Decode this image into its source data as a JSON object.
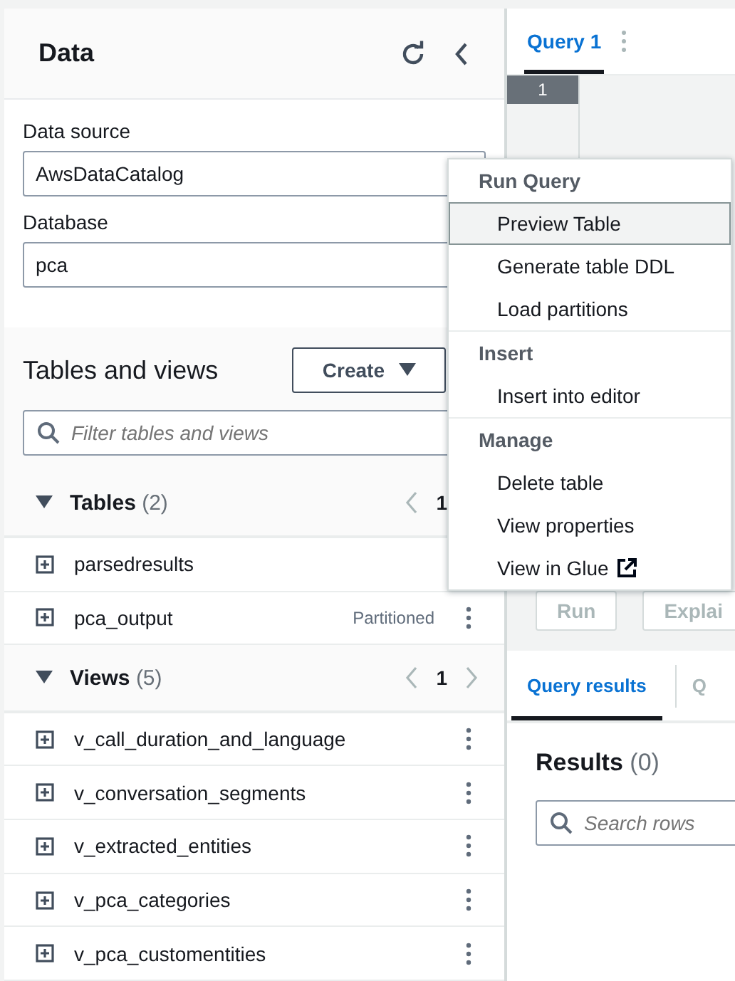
{
  "data_panel": {
    "title": "Data",
    "data_source": {
      "label": "Data source",
      "value": "AwsDataCatalog"
    },
    "database": {
      "label": "Database",
      "value": "pca"
    },
    "tables_and_views": {
      "title": "Tables and views",
      "create_button": "Create",
      "filter": {
        "placeholder": "Filter tables and views"
      },
      "sections": [
        {
          "title": "Tables",
          "count": "(2)",
          "expanded": true,
          "page": "1",
          "next_arrow": false,
          "items": [
            {
              "name": "parsedresults"
            },
            {
              "name": "pca_output",
              "badge": "Partitioned"
            }
          ]
        },
        {
          "title": "Views",
          "count": "(5)",
          "expanded": true,
          "page": "1",
          "next_arrow": true,
          "items": [
            {
              "name": "v_call_duration_and_language"
            },
            {
              "name": "v_conversation_segments"
            },
            {
              "name": "v_extracted_entities"
            },
            {
              "name": "v_pca_categories"
            },
            {
              "name": "v_pca_customentities"
            }
          ]
        }
      ]
    }
  },
  "editor": {
    "tabs": [
      {
        "label": "Query 1",
        "selected": true
      }
    ],
    "line_number": "1",
    "buttons": [
      "Run",
      "Explai"
    ]
  },
  "results": {
    "tabs": [
      {
        "label": "Query results",
        "selected": true
      },
      {
        "label": "Q",
        "selected": false
      }
    ],
    "title": "Results",
    "count": "(0)",
    "search": {
      "placeholder": "Search rows"
    }
  },
  "context_menu": {
    "groups": [
      {
        "heading": "Run Query",
        "items": [
          {
            "label": "Preview Table",
            "selected": true,
            "external": false
          },
          {
            "label": "Generate table DDL",
            "selected": false,
            "external": false
          },
          {
            "label": "Load partitions",
            "selected": false,
            "external": false
          }
        ]
      },
      {
        "heading": "Insert",
        "items": [
          {
            "label": "Insert into editor",
            "selected": false,
            "external": false
          }
        ]
      },
      {
        "heading": "Manage",
        "items": [
          {
            "label": "Delete table",
            "selected": false,
            "external": false
          },
          {
            "label": "View properties",
            "selected": false,
            "external": false
          },
          {
            "label": "View in Glue",
            "selected": false,
            "external": true
          }
        ]
      }
    ]
  }
}
